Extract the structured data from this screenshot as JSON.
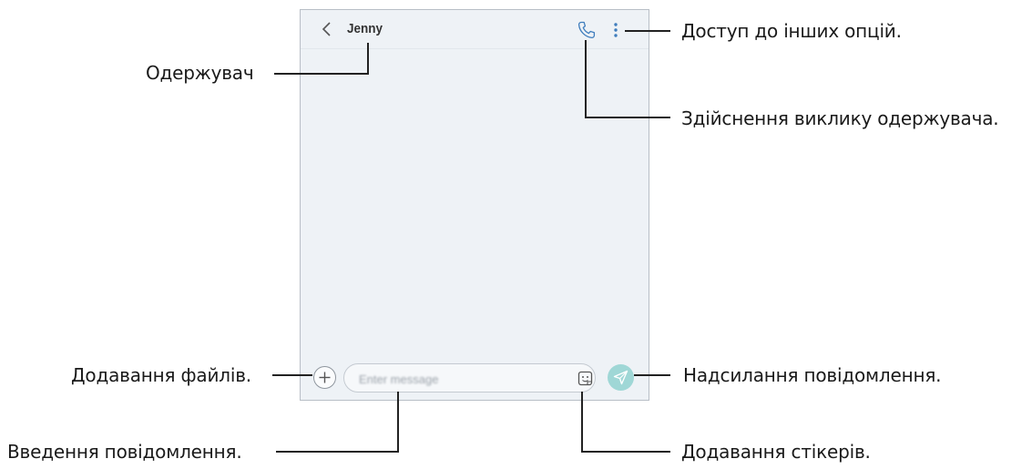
{
  "conversation": {
    "contact_name": "Jenny"
  },
  "composer": {
    "placeholder": "Enter message"
  },
  "callouts": {
    "recipient": "Одержувач",
    "more_options": "Доступ до інших опцій.",
    "call_recipient": "Здійснення виклику одержувача.",
    "attach_files": "Додавання файлів.",
    "send_message": "Надсилання повідомлення.",
    "enter_message": "Введення повідомлення.",
    "add_stickers": "Додавання стікерів."
  },
  "colors": {
    "screen_background": "#eef2f6",
    "send_button": "#9fd7d6",
    "icon_accent": "#3f7dbd",
    "callout_line": "#222222"
  },
  "icons": [
    "back-icon",
    "phone-icon",
    "more-vertical-icon",
    "plus-icon",
    "sticker-icon",
    "send-icon"
  ]
}
